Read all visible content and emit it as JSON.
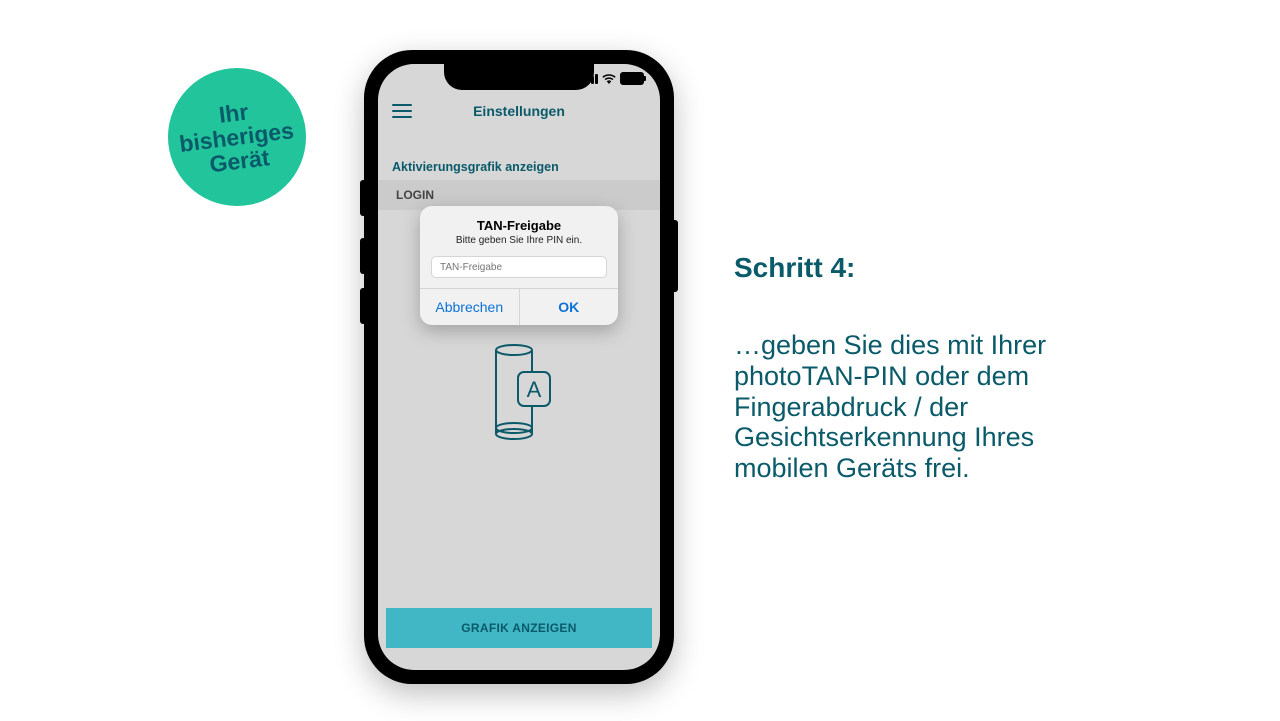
{
  "badge": {
    "line1": "Ihr",
    "line2": "bisheriges",
    "line3": "Gerät"
  },
  "right": {
    "title": "Schritt 4:",
    "body": "…geben Sie dies mit Ihrer photoTAN-PIN oder dem Fingerabdruck / der Gesichtserkennung Ihres mobilen Geräts frei."
  },
  "app": {
    "header_title": "Einstellungen",
    "section_label": "Aktivierungsgrafik anzeigen",
    "login_label": "LOGIN",
    "cta": "GRAFIK ANZEIGEN"
  },
  "dialog": {
    "title": "TAN-Freigabe",
    "subtitle": "Bitte geben Sie Ihre PIN ein.",
    "placeholder": "TAN-Freigabe",
    "cancel": "Abbrechen",
    "ok": "OK"
  },
  "colors": {
    "teal_badge": "#22c49b",
    "brand_text": "#0a5a6a",
    "cta_bg": "#41B6C4",
    "ios_blue": "#0b72d8"
  }
}
